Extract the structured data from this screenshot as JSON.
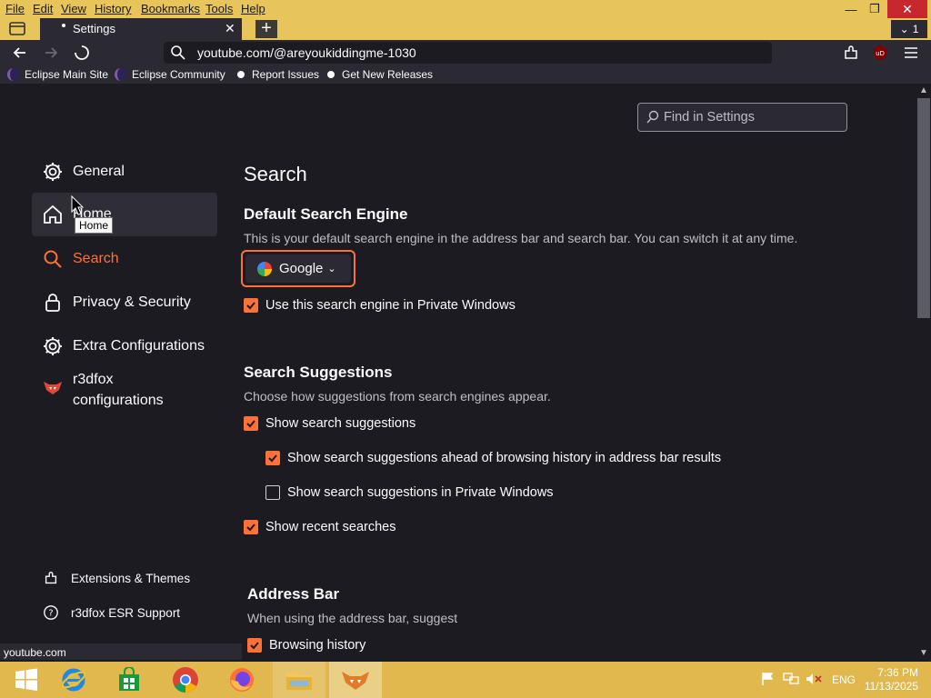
{
  "menubar": {
    "items": [
      "File",
      "Edit",
      "View",
      "History",
      "Bookmarks",
      "Tools",
      "Help"
    ],
    "tab_count": "1"
  },
  "tab": {
    "title": "Settings"
  },
  "urlbar": {
    "url": "youtube.com/@areyoukiddingme-1030"
  },
  "bookmarks": [
    "Eclipse Main Site",
    "Eclipse Community",
    "Report Issues",
    "Get New Releases"
  ],
  "search_settings": {
    "placeholder": "Find in Settings"
  },
  "sidebar": {
    "items": [
      {
        "label": "General",
        "icon": "gear-icon"
      },
      {
        "label": "Home",
        "icon": "home-icon"
      },
      {
        "label": "Search",
        "icon": "search-icon"
      },
      {
        "label": "Privacy & Security",
        "icon": "lock-icon"
      },
      {
        "label": "Extra Configurations",
        "icon": "gear-icon"
      },
      {
        "label": "r3dfox configurations",
        "icon": "fox-icon"
      }
    ],
    "footer": [
      {
        "label": "Extensions & Themes",
        "icon": "puzzle-icon"
      },
      {
        "label": "r3dfox ESR Support",
        "icon": "help-icon"
      }
    ],
    "tooltip": "Home"
  },
  "main": {
    "title": "Search",
    "default_engine": {
      "heading": "Default Search Engine",
      "desc": "This is your default search engine in the address bar and search bar. You can switch it at any time.",
      "selected": "Google",
      "private_checkbox": "Use this search engine in Private Windows",
      "private_checked": true
    },
    "suggestions": {
      "heading": "Search Suggestions",
      "desc": "Choose how suggestions from search engines appear.",
      "items": [
        {
          "label": "Show search suggestions",
          "checked": true
        },
        {
          "label": "Show search suggestions ahead of browsing history in address bar results",
          "checked": true
        },
        {
          "label": "Show search suggestions in Private Windows",
          "checked": false
        },
        {
          "label": "Show recent searches",
          "checked": true
        }
      ]
    },
    "address_bar": {
      "heading": "Address Bar",
      "desc": "When using the address bar, suggest",
      "items": [
        {
          "label": "Browsing history",
          "checked": true
        }
      ]
    }
  },
  "statusbar": {
    "text": "youtube.com"
  },
  "taskbar": {
    "lang": "ENG",
    "time": "7:36 PM",
    "date": "11/13/2025"
  },
  "colors": {
    "accent": "#ff7139",
    "taskbar": "#e1b84d",
    "menubar": "#e8c55a"
  }
}
